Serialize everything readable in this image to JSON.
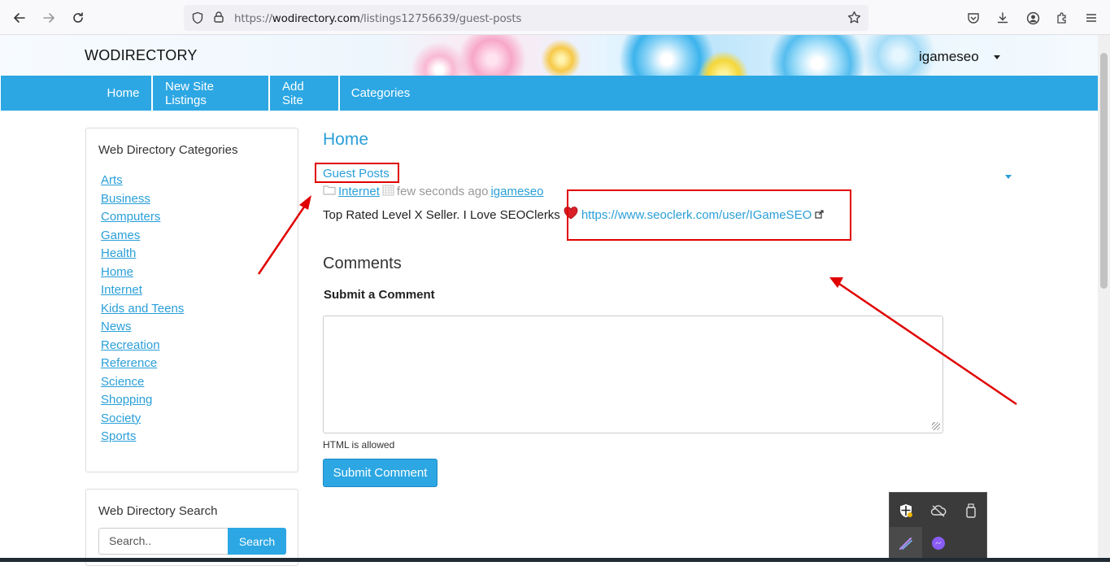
{
  "browser": {
    "url_prefix": "https://",
    "url_domain": "wodirectory.com",
    "url_path": "/listings12756639/guest-posts"
  },
  "site": {
    "logo": "WODIRECTORY",
    "username": "igameseo"
  },
  "nav": {
    "items": [
      {
        "label": "Home"
      },
      {
        "label": "New Site Listings"
      },
      {
        "label": "Add Site"
      },
      {
        "label": "Categories"
      }
    ]
  },
  "sidebar": {
    "categories_title": "Web Directory Categories",
    "categories": [
      {
        "label": "Arts"
      },
      {
        "label": "Business"
      },
      {
        "label": "Computers"
      },
      {
        "label": "Games"
      },
      {
        "label": "Health"
      },
      {
        "label": "Home"
      },
      {
        "label": "Internet"
      },
      {
        "label": "Kids and Teens"
      },
      {
        "label": "News"
      },
      {
        "label": "Recreation"
      },
      {
        "label": "Reference"
      },
      {
        "label": "Science"
      },
      {
        "label": "Shopping"
      },
      {
        "label": "Society"
      },
      {
        "label": "Sports"
      }
    ],
    "search_title": "Web Directory Search",
    "search_placeholder": "Search..",
    "search_button": "Search"
  },
  "main": {
    "title": "Home",
    "listing_title": "Guest Posts",
    "category": "Internet",
    "time": "few seconds ago",
    "author": "igameseo",
    "description": "Top Rated Level X Seller. I Love SEOClerks",
    "link": "https://www.seoclerk.com/user/IGameSEO",
    "comments_heading": "Comments",
    "submit_heading": "Submit a Comment",
    "html_note": "HTML is allowed",
    "submit_button": "Submit Comment"
  },
  "colors": {
    "accent": "#2ca7e3",
    "link": "#2a9fd8",
    "annotation": "#e00000"
  }
}
